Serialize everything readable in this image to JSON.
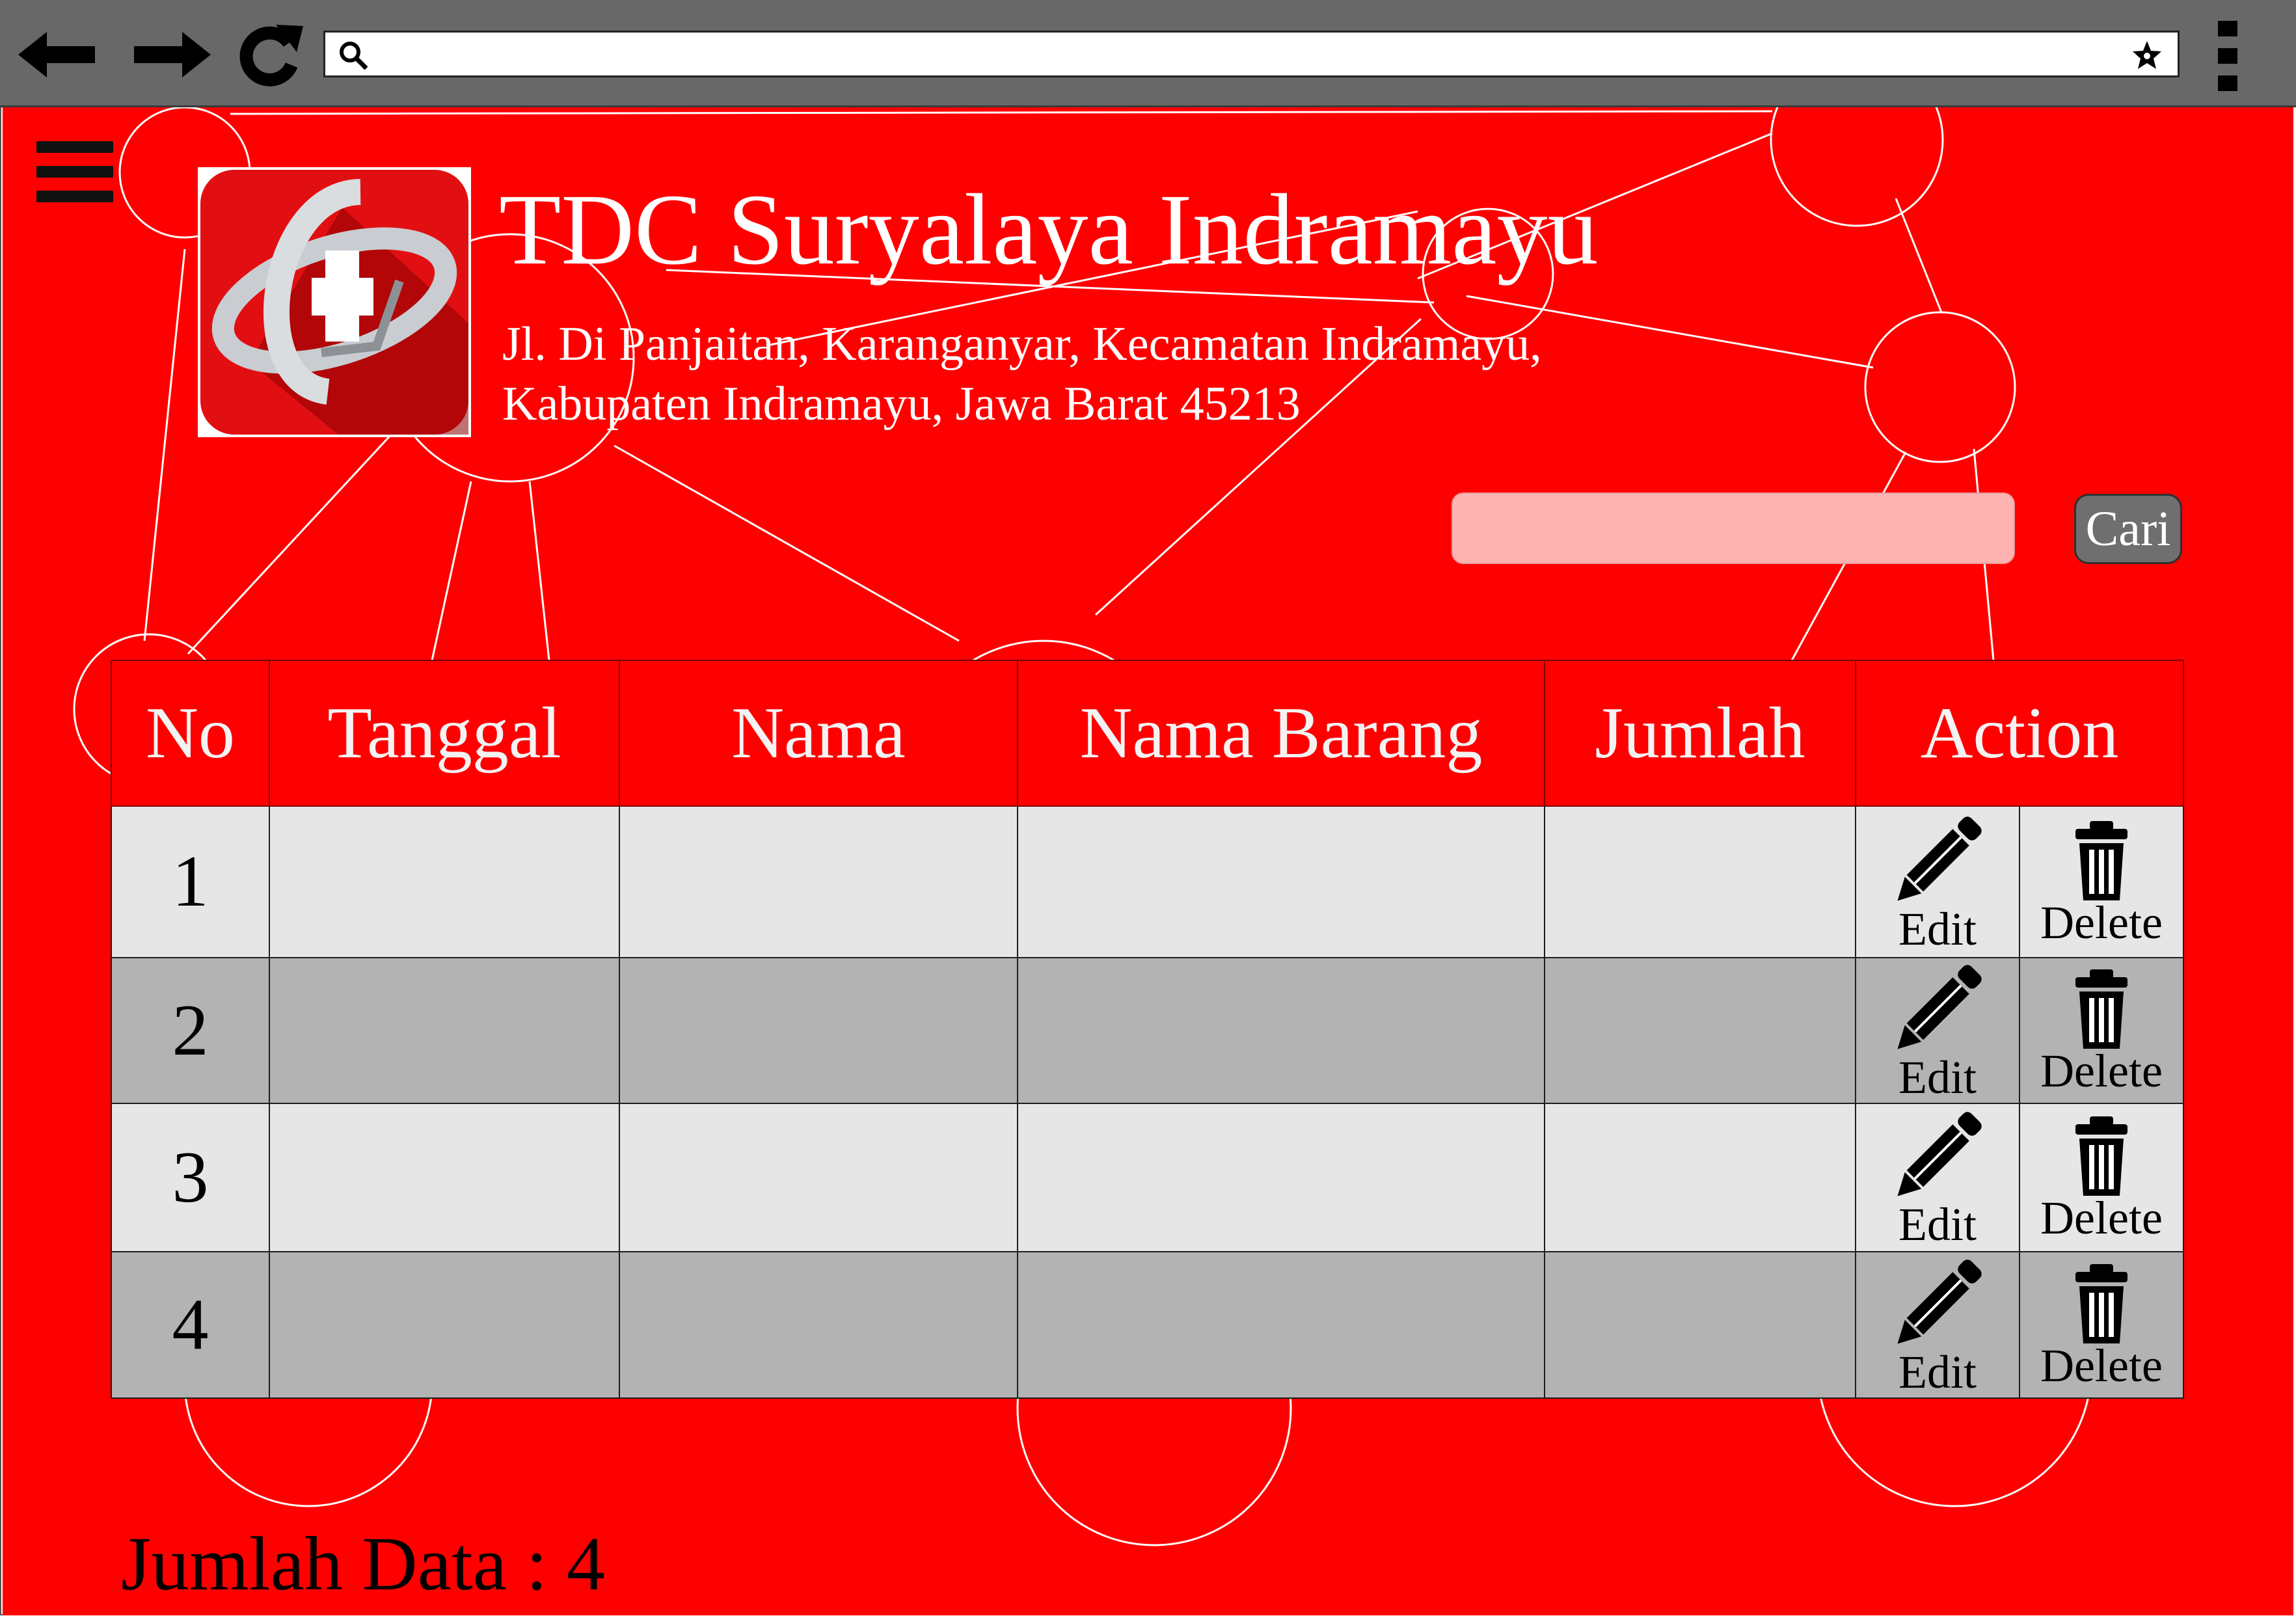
{
  "browser": {
    "address_value": "",
    "icons": [
      "back-arrow-icon",
      "forward-arrow-icon",
      "reload-icon",
      "search-icon",
      "star-bookmark-icon",
      "more-vertical-icon"
    ]
  },
  "header": {
    "title": "TDC Suryalaya Indramayu",
    "address_line1": "Jl. Di Panjaitan, Karanganyar, Kecamatan Indramayu,",
    "address_line2": "Kabupaten Indramayu, Jawa Barat 45213"
  },
  "search": {
    "value": "",
    "button_label": "Cari"
  },
  "table": {
    "headers": [
      "No",
      "Tanggal",
      "Nama",
      "Nama Barang",
      "Jumlah",
      "Action"
    ],
    "rows": [
      {
        "no": "1",
        "tanggal": "",
        "nama": "",
        "nama_barang": "",
        "jumlah": ""
      },
      {
        "no": "2",
        "tanggal": "",
        "nama": "",
        "nama_barang": "",
        "jumlah": ""
      },
      {
        "no": "3",
        "tanggal": "",
        "nama": "",
        "nama_barang": "",
        "jumlah": ""
      },
      {
        "no": "4",
        "tanggal": "",
        "nama": "",
        "nama_barang": "",
        "jumlah": ""
      }
    ],
    "edit_label": "Edit",
    "delete_label": "Delete"
  },
  "footer": {
    "data_count": "Jumlah Data : 4"
  },
  "colors": {
    "page_background": "#ff0000",
    "row_light": "#e6e6e6",
    "row_dark": "#b3b3b3",
    "search_field": "#ffb3b3",
    "search_button": "#6f6f6f"
  }
}
